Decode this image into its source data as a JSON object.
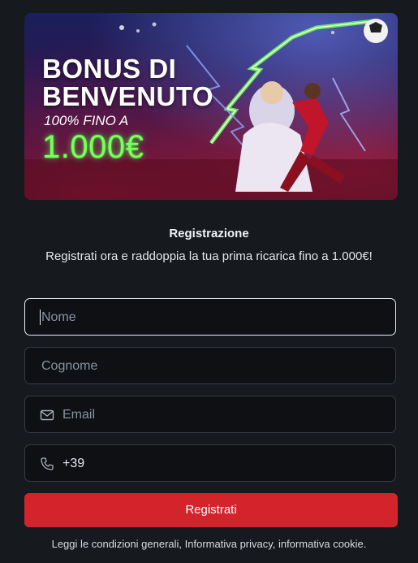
{
  "banner": {
    "line1": "BONUS DI",
    "line2": "BENVENUTO",
    "line3": "100% FINO A",
    "amount": "1.000€"
  },
  "form": {
    "title": "Registrazione",
    "subtitle": "Registrati ora e raddoppia la tua prima ricarica fino a 1.000€!",
    "nome_placeholder": "Nome",
    "cognome_placeholder": "Cognome",
    "email_placeholder": "Email",
    "phone_prefix": "+39",
    "submit_label": "Registrati",
    "terms": "Leggi le condizioni generali, Informativa privacy, informativa cookie."
  },
  "colors": {
    "background": "#16191e",
    "field_bg": "#0e1014",
    "button": "#d3242b",
    "amount_glow": "#7cff5a"
  },
  "icons": {
    "email": "mail-icon",
    "phone": "phone-icon"
  }
}
